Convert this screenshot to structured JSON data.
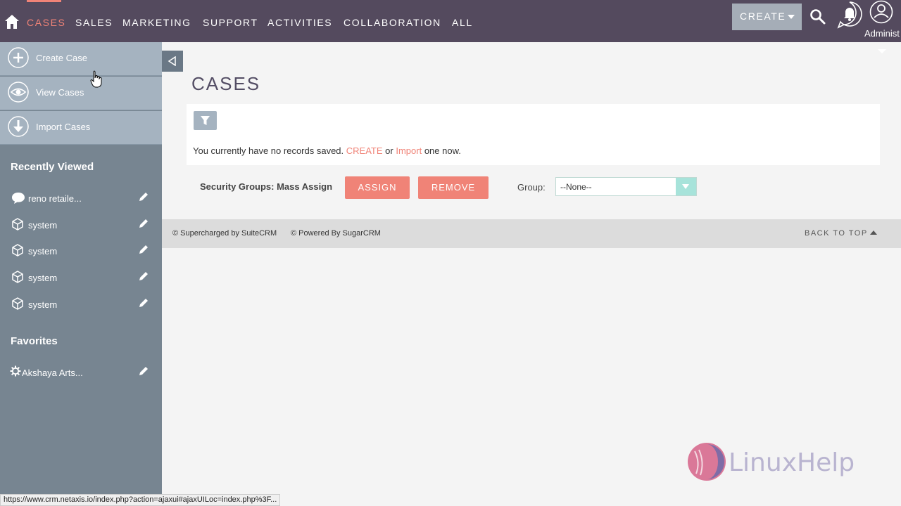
{
  "nav": {
    "items": [
      "CASES",
      "SALES",
      "MARKETING",
      "SUPPORT",
      "ACTIVITIES",
      "COLLABORATION",
      "ALL"
    ],
    "create_label": "CREATE",
    "user_label": "Administ"
  },
  "sidebar": {
    "actions": [
      "Create Case",
      "View Cases",
      "Import Cases"
    ],
    "recently_viewed_title": "Recently Viewed",
    "recently_viewed": [
      "reno retaile...",
      "system",
      "system",
      "system",
      "system"
    ],
    "favorites_title": "Favorites",
    "favorites": [
      "Akshaya Arts..."
    ]
  },
  "main": {
    "title": "CASES",
    "msg_before": "You currently have no records saved.",
    "msg_create": "CREATE",
    "msg_or": "or",
    "msg_import": "Import",
    "msg_after": "one now.",
    "mass_assign_label": "Security Groups: Mass Assign",
    "assign_label": "ASSIGN",
    "remove_label": "REMOVE",
    "group_label": "Group:",
    "group_value": "--None--"
  },
  "footer": {
    "supercharged": "© Supercharged by SuiteCRM",
    "powered": "© Powered By SugarCRM",
    "back_to_top": "BACK TO TOP"
  },
  "watermark": "LinuxHelp",
  "status_url": "https://www.crm.netaxis.io/index.php?action=ajaxui#ajaxUILoc=index.php%3F...",
  "colors": {
    "nav_bg": "#544a5e",
    "accent": "#f08377",
    "sidebar_bg": "#778591",
    "sidebar_action_bg": "#a5b3c0"
  }
}
